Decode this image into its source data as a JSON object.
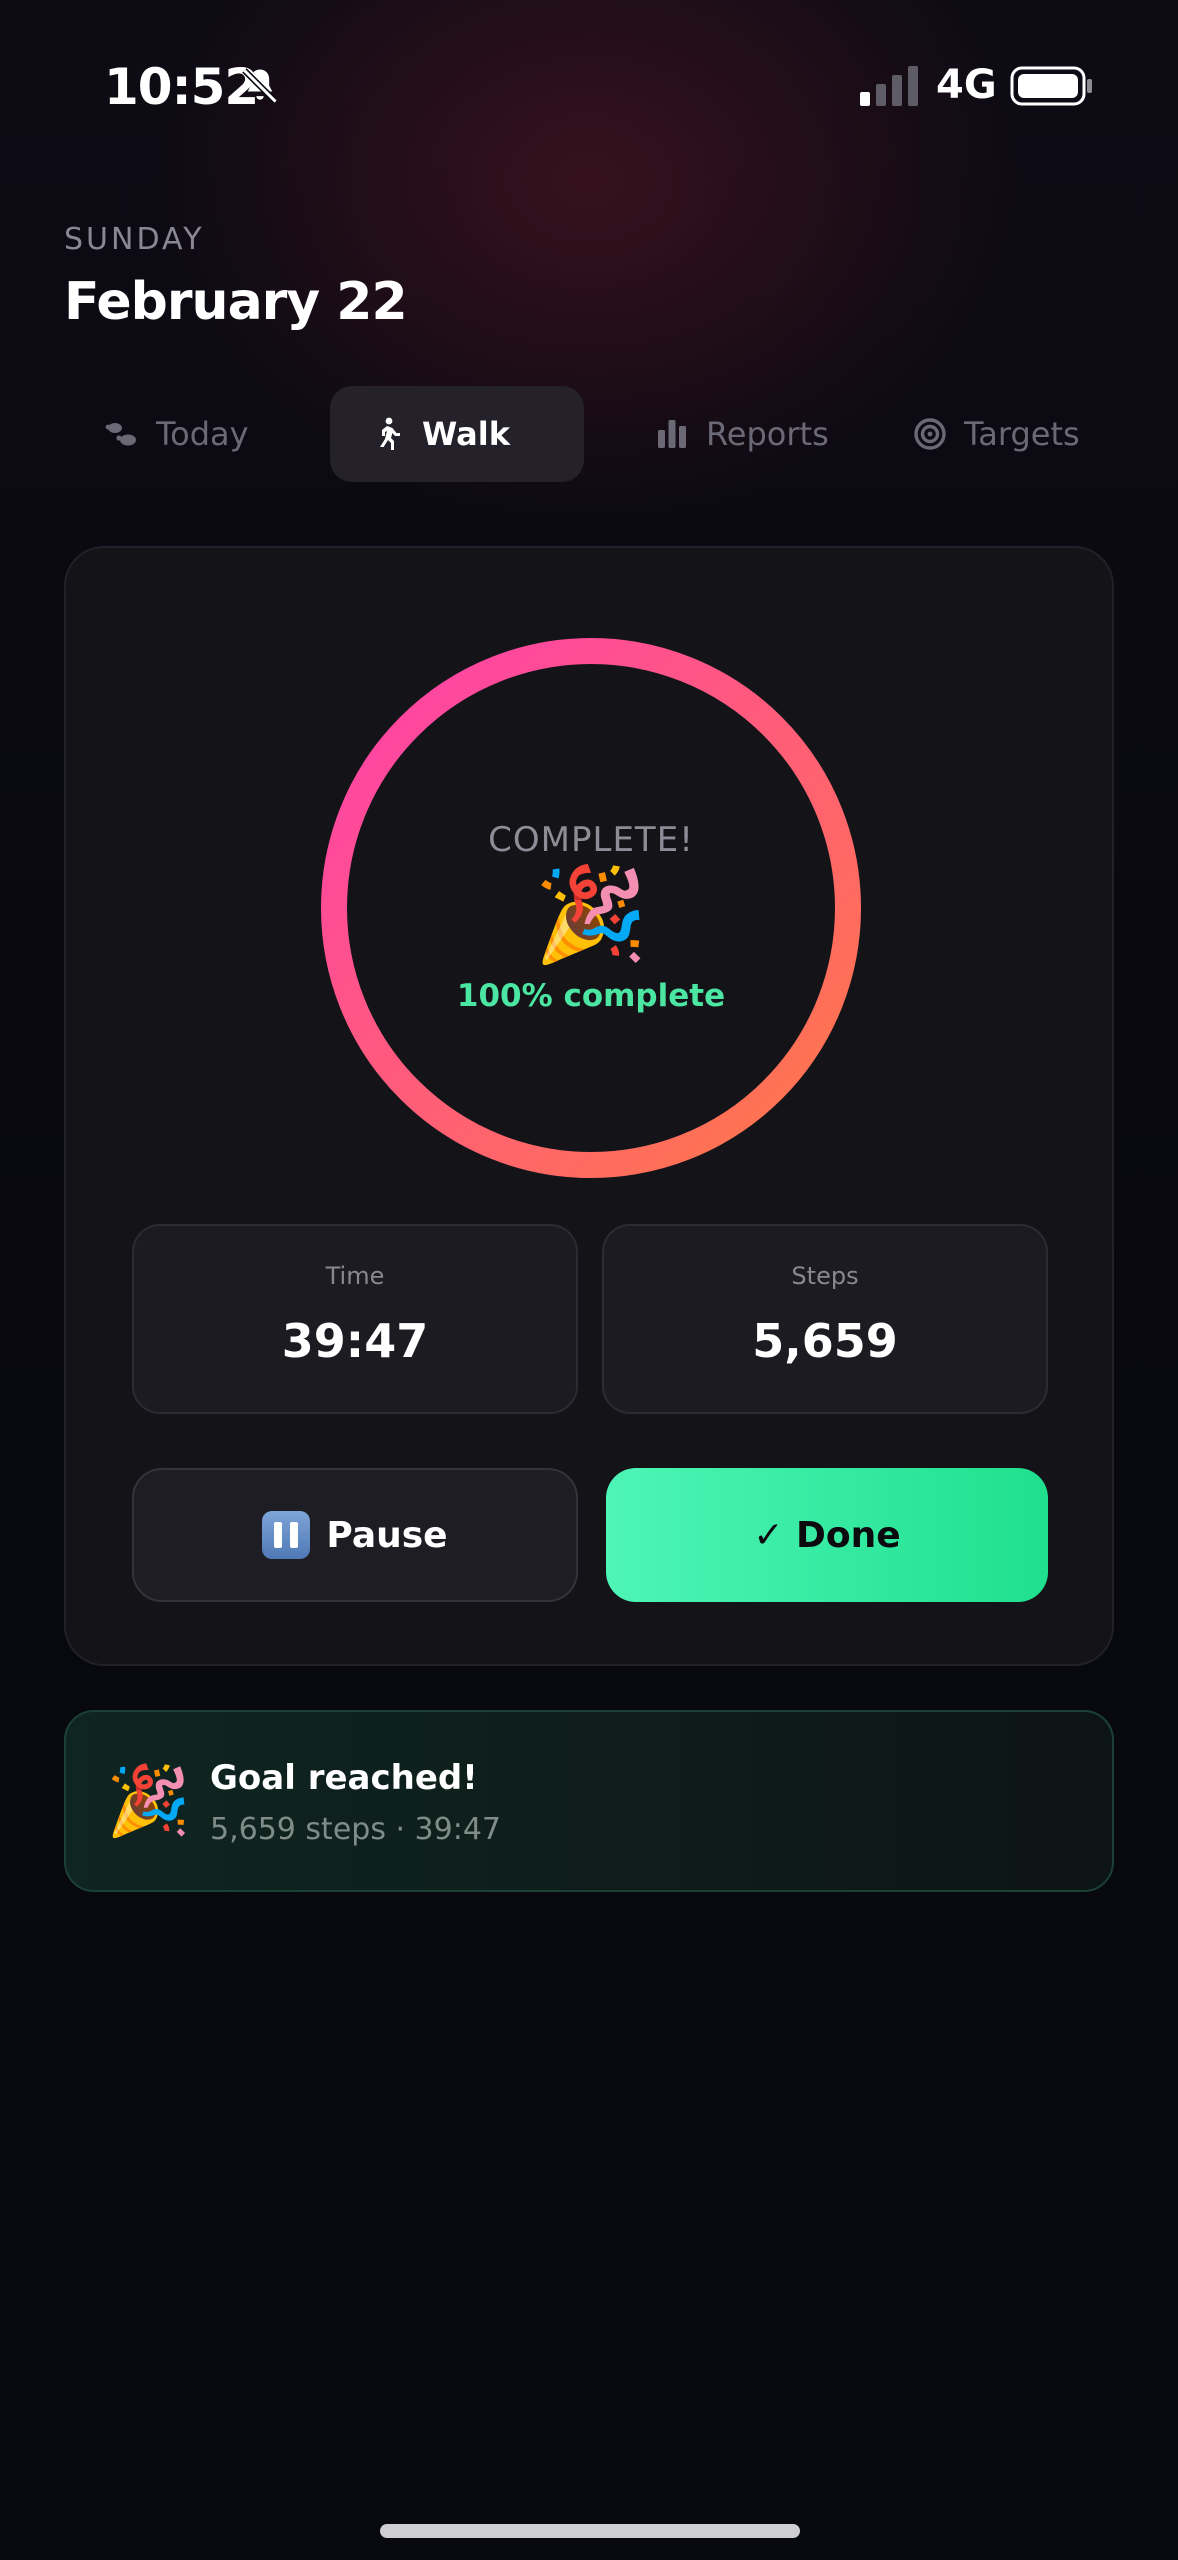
{
  "status_bar": {
    "time": "10:52",
    "network": "4G",
    "icons": [
      "bell-slash-icon",
      "signal-icon",
      "battery-icon"
    ]
  },
  "header": {
    "day": "SUNDAY",
    "date": "February 22"
  },
  "tabs": [
    {
      "label": "Today",
      "icon": "footprints-icon",
      "active": false
    },
    {
      "label": "Walk",
      "icon": "walking-person-icon",
      "active": true
    },
    {
      "label": "Reports",
      "icon": "bar-chart-icon",
      "active": false
    },
    {
      "label": "Targets",
      "icon": "target-icon",
      "active": false
    }
  ],
  "walk": {
    "ring_title": "COMPLETE!",
    "ring_emoji": "🎉",
    "progress_text": "100% complete",
    "progress_fraction": 1.0,
    "stats": {
      "time_label": "Time",
      "time_value": "39:47",
      "steps_label": "Steps",
      "steps_value": "5,659"
    },
    "pause_label": "Pause",
    "done_label": "✓ Done"
  },
  "goal": {
    "emoji": "🎉",
    "title": "Goal reached!",
    "detail": "5,659 steps · 39:47"
  },
  "colors": {
    "background": "#08080f",
    "ring_start": "#ff7a45",
    "ring_end": "#ff3fae",
    "accent_green": "#4be6a2",
    "active_tab": "#24212b"
  }
}
